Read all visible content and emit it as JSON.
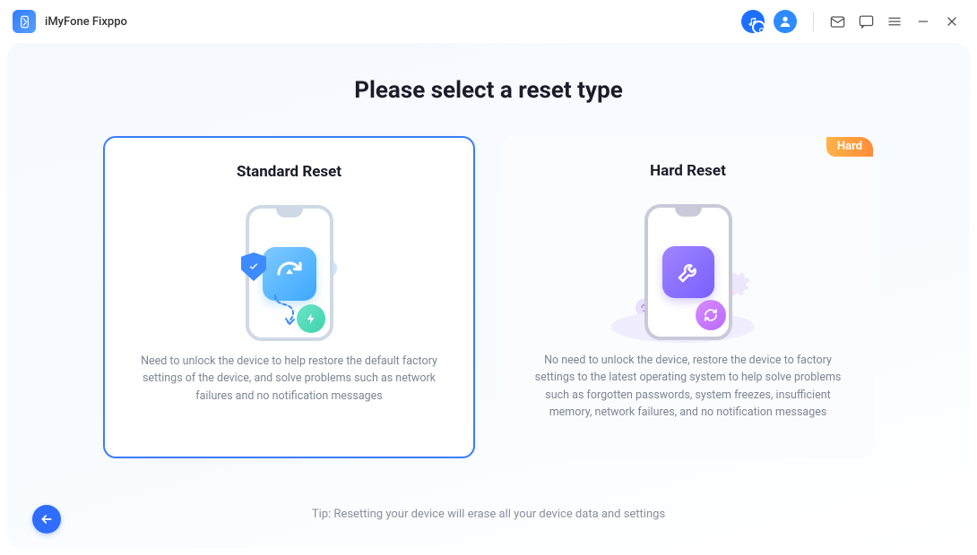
{
  "app": {
    "title": "iMyFone Fixppo"
  },
  "page": {
    "title": "Please select a reset type"
  },
  "cards": {
    "standard": {
      "title": "Standard Reset",
      "desc": "Need to unlock the device to help restore the default factory settings of the device, and solve problems such as network failures and no notification messages"
    },
    "hard": {
      "title": "Hard Reset",
      "badge": "Hard",
      "desc": "No need to unlock the device, restore the device to factory settings to the latest operating system to help solve problems such as forgotten passwords, system freezes, insufficient memory, network failures, and no notification messages"
    }
  },
  "footer": {
    "tip": "Tip: Resetting your device will erase all your device data and settings"
  }
}
